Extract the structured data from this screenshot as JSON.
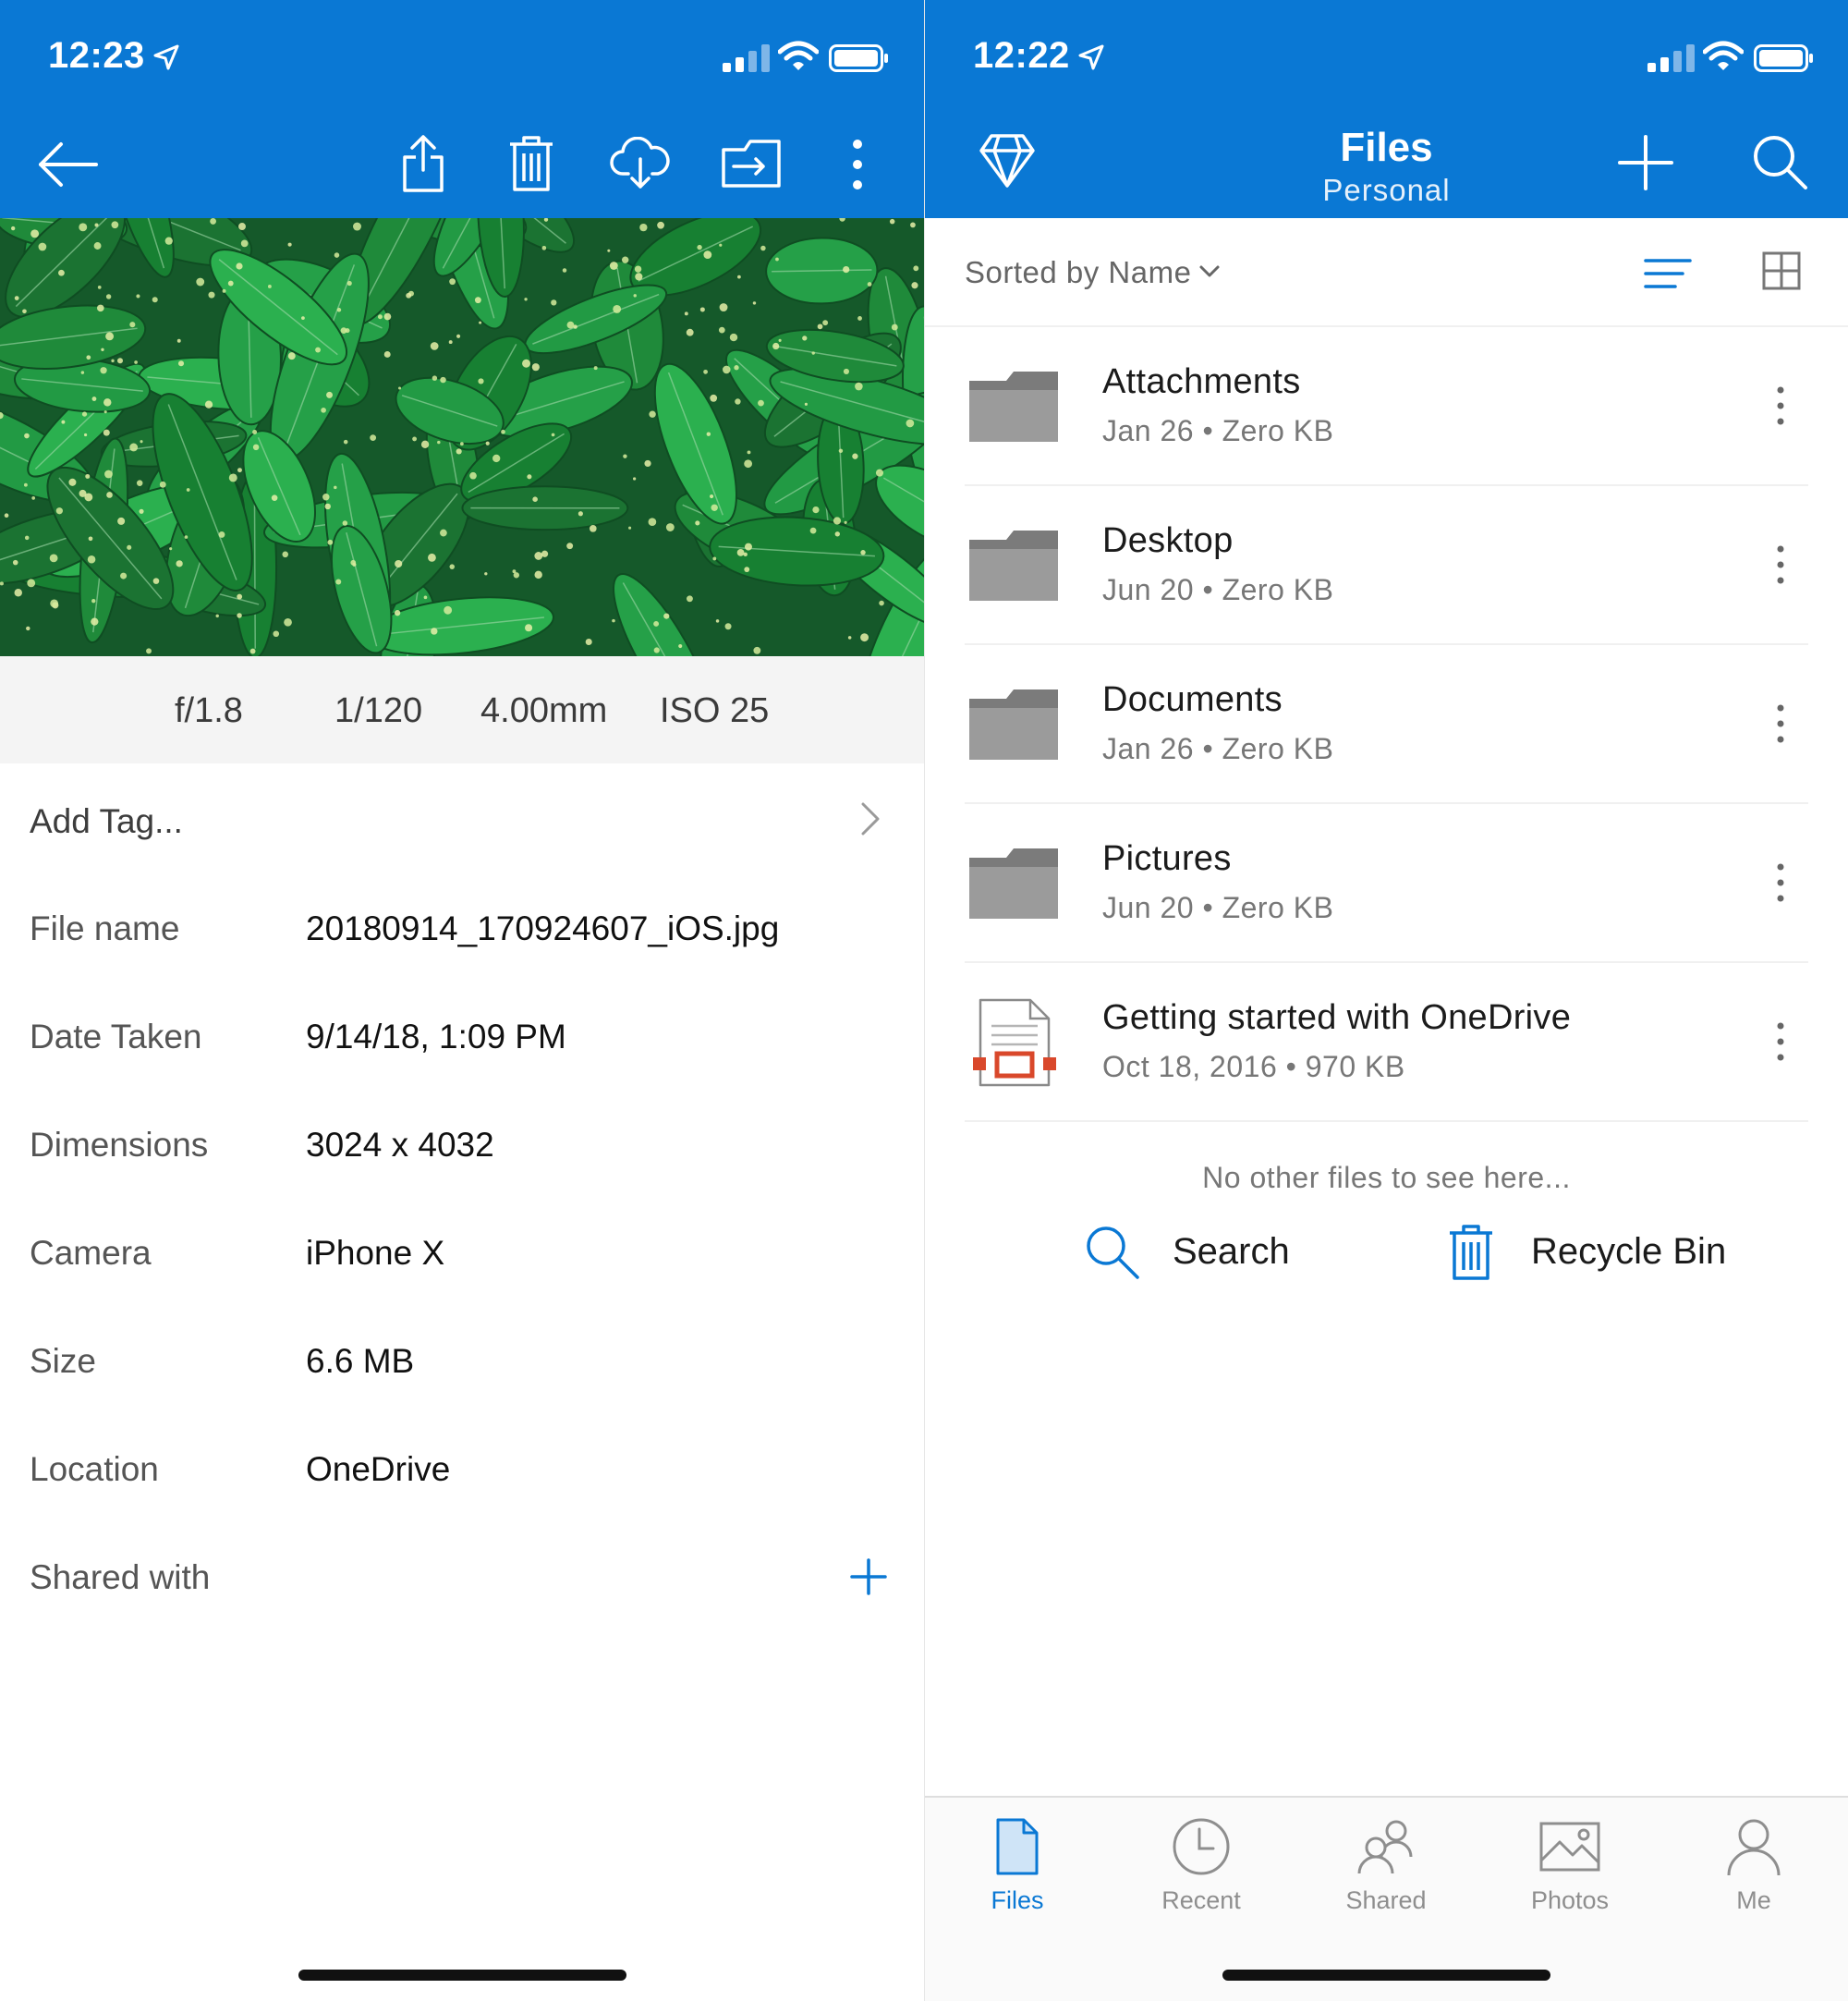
{
  "left_screen": {
    "status": {
      "time": "12:23"
    },
    "toolbar_icons": [
      "back-arrow-icon",
      "share-icon",
      "delete-icon",
      "download-icon",
      "move-icon",
      "more-icon"
    ],
    "exif": {
      "aperture": "f/1.8",
      "shutter": "1/120",
      "focal_length": "4.00mm",
      "iso": "ISO 25"
    },
    "add_tag": "Add Tag...",
    "properties": [
      {
        "label": "File name",
        "value": "20180914_170924607_iOS.jpg"
      },
      {
        "label": "Date Taken",
        "value": "9/14/18, 1:09 PM"
      },
      {
        "label": "Dimensions",
        "value": "3024 x 4032"
      },
      {
        "label": "Camera",
        "value": "iPhone X"
      },
      {
        "label": "Size",
        "value": "6.6 MB"
      },
      {
        "label": "Location",
        "value": "OneDrive"
      }
    ],
    "shared_with": "Shared with"
  },
  "right_screen": {
    "status": {
      "time": "12:22"
    },
    "header": {
      "title": "Files",
      "subtitle": "Personal"
    },
    "sort": {
      "label": "Sorted by Name"
    },
    "files": [
      {
        "name": "Attachments",
        "meta": "Jan 26 • Zero KB",
        "type": "folder"
      },
      {
        "name": "Desktop",
        "meta": "Jun 20 • Zero KB",
        "type": "folder"
      },
      {
        "name": "Documents",
        "meta": "Jan 26 • Zero KB",
        "type": "folder"
      },
      {
        "name": "Pictures",
        "meta": "Jun 20 • Zero KB",
        "type": "folder"
      },
      {
        "name": "Getting started with OneDrive",
        "meta": "Oct 18, 2016 • 970 KB",
        "type": "pdf"
      }
    ],
    "empty_message": "No other files to see here...",
    "actions": {
      "search": "Search",
      "recycle_bin": "Recycle Bin"
    },
    "tabs": [
      {
        "label": "Files",
        "icon": "file-icon",
        "active": true
      },
      {
        "label": "Recent",
        "icon": "clock-icon",
        "active": false
      },
      {
        "label": "Shared",
        "icon": "people-icon",
        "active": false
      },
      {
        "label": "Photos",
        "icon": "photo-icon",
        "active": false
      },
      {
        "label": "Me",
        "icon": "person-icon",
        "active": false
      }
    ]
  },
  "colors": {
    "accent": "#0a78d4",
    "folder": "#8a8a8a",
    "pdf_red": "#d9482b"
  }
}
